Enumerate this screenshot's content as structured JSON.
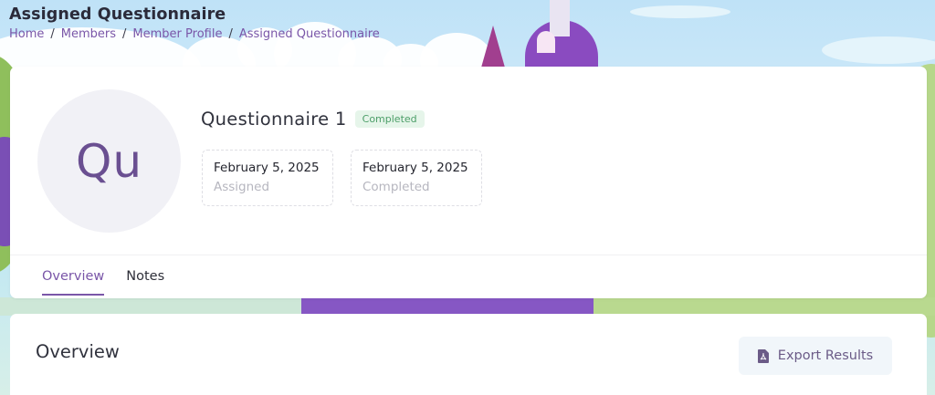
{
  "header": {
    "title": "Assigned Questionnaire",
    "breadcrumb": [
      "Home",
      "Members",
      "Member Profile",
      "Assigned Questionnaire"
    ]
  },
  "profile": {
    "avatar_initials": "Qu",
    "name": "Questionnaire 1",
    "status": "Completed",
    "stats": [
      {
        "value": "February 5, 2025",
        "label": "Assigned"
      },
      {
        "value": "February 5, 2025",
        "label": "Completed"
      }
    ]
  },
  "tabs": [
    {
      "label": "Overview",
      "active": true
    },
    {
      "label": "Notes",
      "active": false
    }
  ],
  "overview": {
    "title": "Overview",
    "export_label": "Export Results"
  },
  "colors": {
    "accent": "#7a56a8",
    "success_text": "#4c9e68",
    "success_bg": "#e6f5ea"
  },
  "icons": {
    "export": "pdf-file-icon"
  }
}
